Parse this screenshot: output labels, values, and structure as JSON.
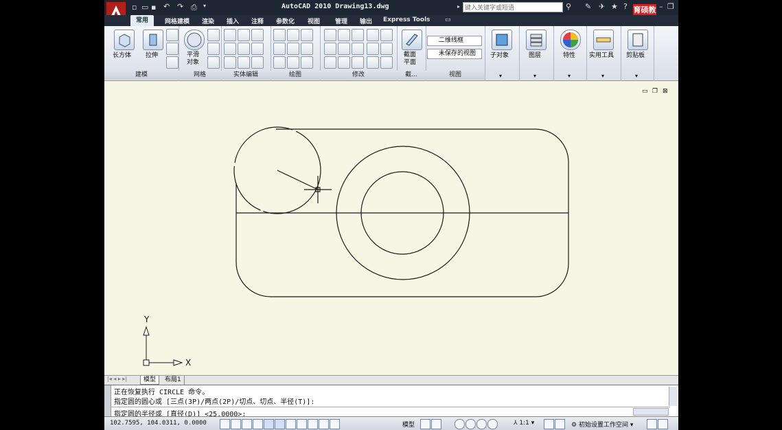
{
  "title": "AutoCAD 2010   Drawing13.dwg",
  "search_placeholder": "键入关键字或短语",
  "watermark": "育硕教育",
  "menus": [
    "常用",
    "网格建模",
    "渲染",
    "插入",
    "注释",
    "参数化",
    "视图",
    "管理",
    "输出",
    "Express Tools"
  ],
  "panels": {
    "modeling": "建模",
    "mesh": "网格",
    "solid_edit": "实体编辑",
    "draw": "绘图",
    "modify": "修改",
    "section": "截...",
    "view": "视图"
  },
  "big_tools": {
    "box": "长方体",
    "extrude": "拉伸",
    "smooth_line1": "平滑",
    "smooth_line2": "对象",
    "section_line1": "截面",
    "section_line2": "平面",
    "subobject": "子对象",
    "layers": "图层",
    "properties": "特性",
    "utilities": "实用工具",
    "clipboard": "剪贴板"
  },
  "view_dropdowns": [
    "二维线框",
    "未保存的视图"
  ],
  "ucs": {
    "x": "X",
    "y": "Y"
  },
  "layout_tabs": [
    "模型",
    "布局1"
  ],
  "command_lines": [
    "正在恢复执行 CIRCLE 命令。",
    "指定圆的圆心或 [三点(3P)/两点(2P)/切点、切点、半径(T)]:",
    "指定圆的半径或 [直径(D)] <25.0000>:"
  ],
  "status": {
    "coords": "102.7595, 104.0311, 0.0000",
    "model": "模型",
    "scale": "1:1",
    "workspace": "初始设置工作空间"
  },
  "colors": {
    "canvas": "#f6f6e4",
    "linework": "#1a1a1a",
    "ribbon": "#e4e9f0",
    "title_bg": "#1e2533"
  }
}
